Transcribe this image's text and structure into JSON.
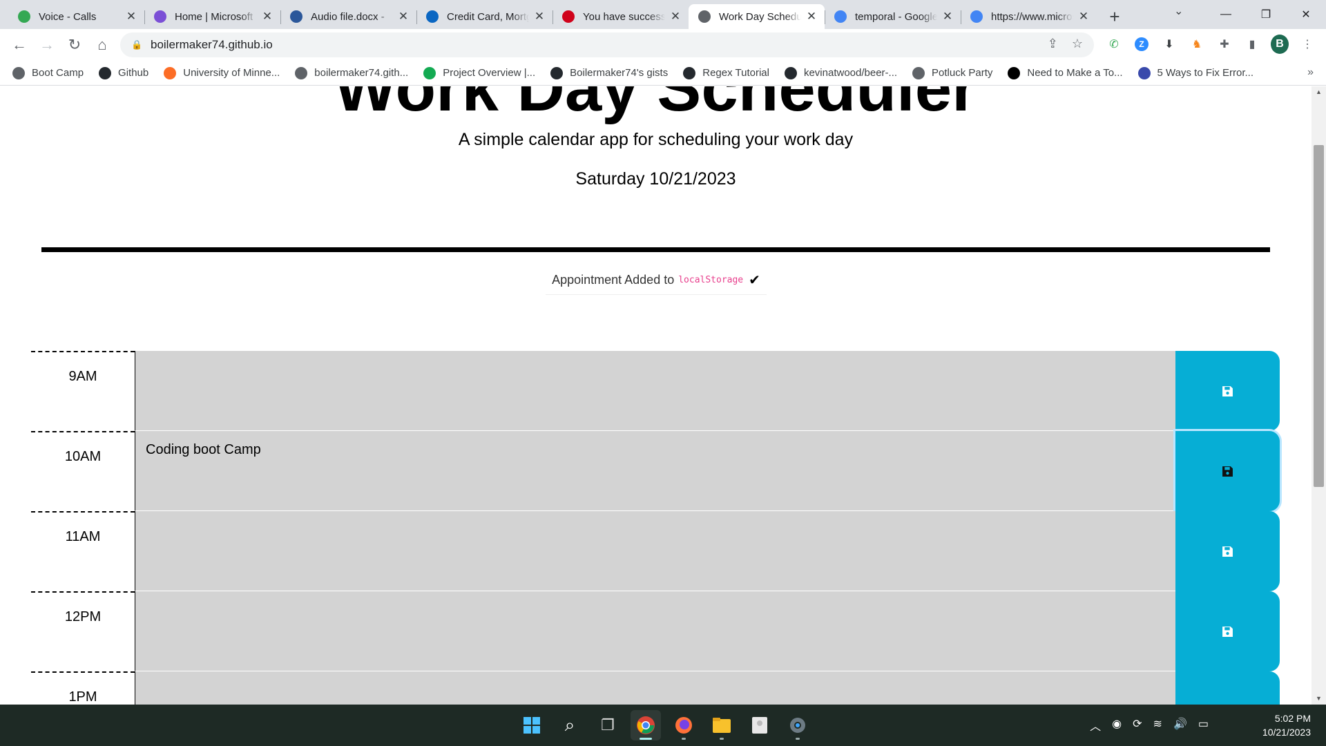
{
  "browser": {
    "tabs": [
      {
        "title": "Voice - Calls",
        "favicon": "google-voice-icon",
        "color": "#34a853"
      },
      {
        "title": "Home | Microsoft",
        "favicon": "microsoft-icon",
        "color": "#7b4fd6"
      },
      {
        "title": "Audio file.docx -",
        "favicon": "word-icon",
        "color": "#2b579a"
      },
      {
        "title": "Credit Card, Mortgage",
        "favicon": "bank-icon",
        "color": "#0a66c2"
      },
      {
        "title": "You have successfully",
        "favicon": "bank-red-icon",
        "color": "#d0021b"
      },
      {
        "title": "Work Day Scheduler",
        "favicon": "globe-icon",
        "color": "#5f6368",
        "active": true
      },
      {
        "title": "temporal - Google",
        "favicon": "google-icon",
        "color": "#4285f4"
      },
      {
        "title": "https://www.microsoft",
        "favicon": "google-icon",
        "color": "#4285f4"
      }
    ],
    "url": "boilermaker74.github.io",
    "bookmarks": [
      {
        "label": "Boot Camp",
        "icon": "globe-icon",
        "color": "#5f6368"
      },
      {
        "label": "Github",
        "icon": "github-icon",
        "color": "#24292e"
      },
      {
        "label": "University of Minne...",
        "icon": "gitlab-icon",
        "color": "#fc6d26"
      },
      {
        "label": "boilermaker74.gith...",
        "icon": "globe-icon",
        "color": "#5f6368"
      },
      {
        "label": "Project Overview |...",
        "icon": "mongodb-icon",
        "color": "#13aa52"
      },
      {
        "label": "Boilermaker74's gists",
        "icon": "github-icon",
        "color": "#24292e"
      },
      {
        "label": "Regex Tutorial",
        "icon": "github-icon",
        "color": "#24292e"
      },
      {
        "label": "kevinatwood/beer-...",
        "icon": "github-icon",
        "color": "#24292e"
      },
      {
        "label": "Potluck Party",
        "icon": "globe-icon",
        "color": "#5f6368"
      },
      {
        "label": "Need to Make a To...",
        "icon": "codepen-icon",
        "color": "#000000"
      },
      {
        "label": "5 Ways to Fix Error...",
        "icon": "grid-icon",
        "color": "#3949ab"
      }
    ]
  },
  "page": {
    "title": "Work Day Scheduler",
    "lead": "A simple calendar app for scheduling your work day",
    "current_day": "Saturday 10/21/2023",
    "notice": {
      "text": "Appointment Added to",
      "code": "localStorage"
    },
    "accent": "#06aed5",
    "rows": [
      {
        "hour": "9AM",
        "text": ""
      },
      {
        "hour": "10AM",
        "text": "Coding boot Camp"
      },
      {
        "hour": "11AM",
        "text": ""
      },
      {
        "hour": "12PM",
        "text": ""
      },
      {
        "hour": "1PM",
        "text": ""
      }
    ]
  },
  "taskbar": {
    "apps": [
      "start-icon",
      "search-icon",
      "task-view-icon",
      "chrome-icon",
      "firefox-icon",
      "file-explorer-icon",
      "notepad-icon",
      "settings-icon"
    ],
    "time": "5:02 PM",
    "date": "10/21/2023"
  }
}
